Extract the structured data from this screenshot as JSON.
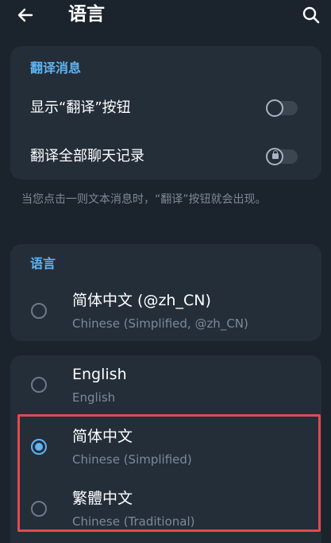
{
  "header": {
    "title": "语言",
    "back_icon": "arrow-left-icon",
    "search_icon": "search-icon"
  },
  "translate_section": {
    "header": "翻译消息",
    "show_button_label": "显示“翻译”按钮",
    "show_button_on": false,
    "translate_all_label": "翻译全部聊天记录",
    "translate_all_on": false,
    "translate_all_locked": true
  },
  "hint": "当您点击一则文本消息时，“翻译”按钮就会出现。",
  "language_section": {
    "header": "语言",
    "current": {
      "name": "简体中文 (@zh_CN)",
      "subtitle": "Chinese (Simplified, @zh_CN)",
      "selected": false
    }
  },
  "language_list": [
    {
      "name": "English",
      "subtitle": "English",
      "selected": false
    },
    {
      "name": "简体中文",
      "subtitle": "Chinese (Simplified)",
      "selected": true
    },
    {
      "name": "繁體中文",
      "subtitle": "Chinese (Traditional)",
      "selected": false
    }
  ],
  "colors": {
    "background": "#1b232c",
    "card": "#242e39",
    "accent": "#5fb4f3",
    "highlight": "#e24a4f"
  }
}
